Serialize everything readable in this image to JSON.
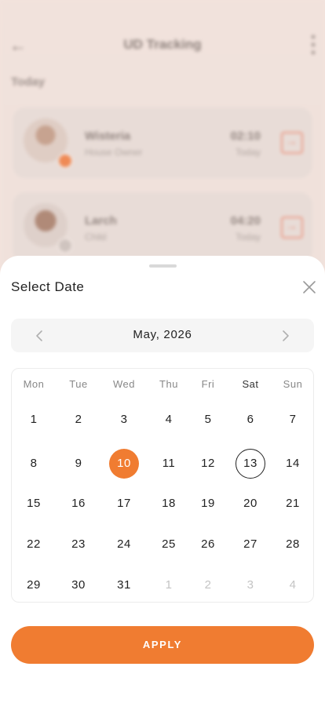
{
  "background": {
    "title": "UD Tracking",
    "section": "Today",
    "cards": [
      {
        "name": "Wisteria",
        "role": "House Owner",
        "time": "02:10",
        "day": "Today"
      },
      {
        "name": "Larch",
        "role": "Child",
        "time": "04:20",
        "day": "Today"
      }
    ]
  },
  "sheet": {
    "title": "Select Date",
    "month_label": "May, 2026",
    "weekdays": [
      "Mon",
      "Tue",
      "Wed",
      "Thu",
      "Fri",
      "Sat",
      "Sun"
    ],
    "weeks": [
      [
        "1",
        "2",
        "3",
        "4",
        "5",
        "6",
        "7"
      ],
      [
        "8",
        "9",
        "10",
        "11",
        "12",
        "13",
        "14"
      ],
      [
        "15",
        "16",
        "17",
        "18",
        "19",
        "20",
        "21"
      ],
      [
        "22",
        "23",
        "24",
        "25",
        "26",
        "27",
        "28"
      ],
      [
        "29",
        "30",
        "31",
        "1",
        "2",
        "3",
        "4"
      ]
    ],
    "selected_day": "10",
    "today_day": "13",
    "apply_label": "APPLY"
  },
  "colors": {
    "accent": "#f07c31",
    "text": "#222222",
    "muted": "#c4c4c4"
  },
  "icons": [
    "back-arrow-icon",
    "more-vertical-icon",
    "logout-icon",
    "close-icon",
    "chevron-left-icon",
    "chevron-right-icon"
  ]
}
